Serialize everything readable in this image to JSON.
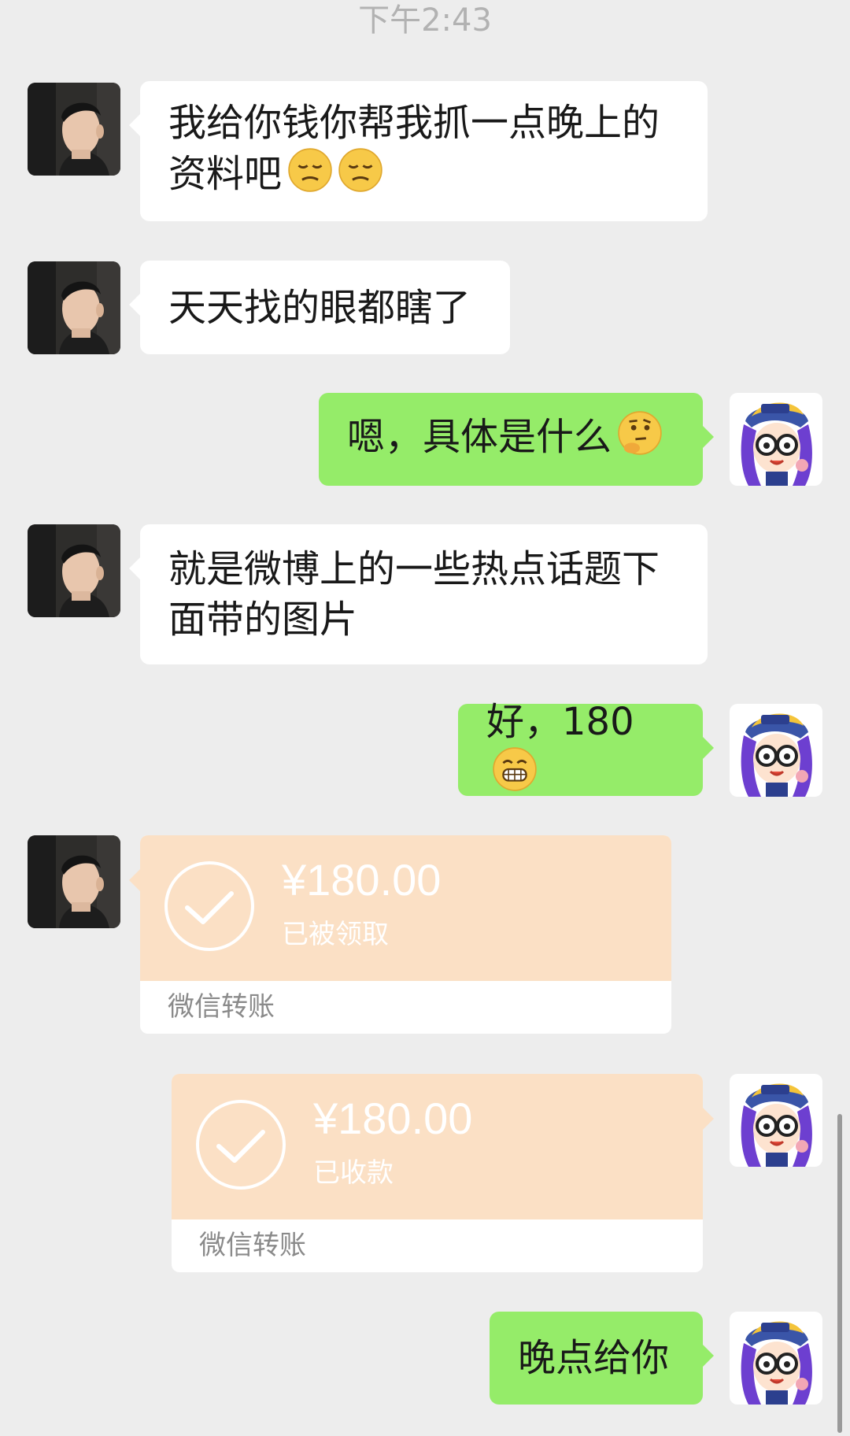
{
  "timestamp": "下午2:43",
  "messages": [
    {
      "sender": "other",
      "text": "我给你钱你帮我抓一点晚上的资料吧",
      "emojis": [
        "pensive-face",
        "pensive-face"
      ]
    },
    {
      "sender": "other",
      "text": "天天找的眼都瞎了"
    },
    {
      "sender": "me",
      "text": "嗯，具体是什么",
      "emojis": [
        "thinking-face"
      ]
    },
    {
      "sender": "other",
      "text": "就是微博上的一些热点话题下面带的图片"
    },
    {
      "sender": "me",
      "text": "好，180",
      "emojis": [
        "grimacing-face"
      ]
    },
    {
      "sender": "other",
      "type": "transfer",
      "amount": "¥180.00",
      "status": "已被领取",
      "footer": "微信转账"
    },
    {
      "sender": "me",
      "type": "transfer",
      "amount": "¥180.00",
      "status": "已收款",
      "footer": "微信转账"
    },
    {
      "sender": "me",
      "text": "晚点给你"
    }
  ],
  "colors": {
    "background": "#ededed",
    "my_bubble": "#95ec69",
    "other_bubble": "#ffffff",
    "transfer": "#fbe0c5"
  }
}
